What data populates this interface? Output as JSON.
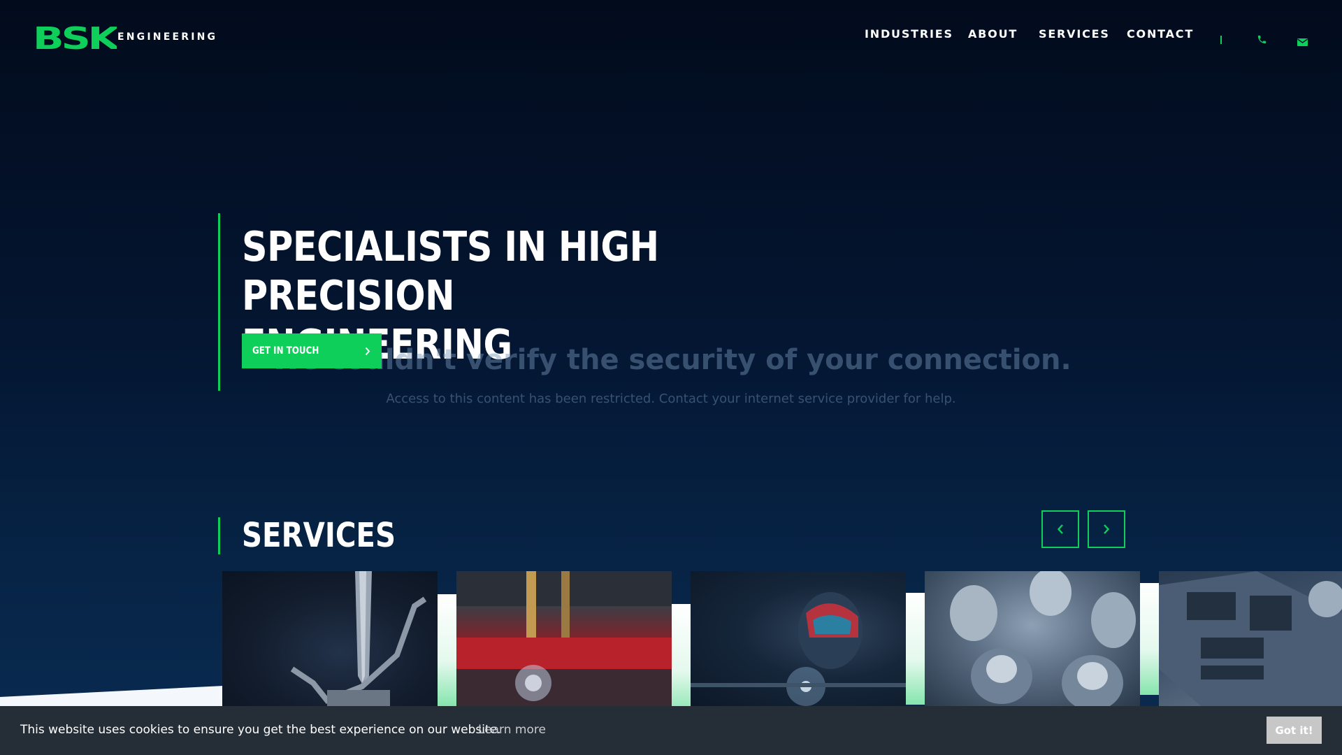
{
  "brand": {
    "logo_letters": "BSK",
    "logo_subtitle": "ENGINEERING",
    "accent_color": "#0fcf5b"
  },
  "nav": {
    "items": [
      "INDUSTRIES",
      "ABOUT",
      "SERVICES",
      "CONTACT"
    ],
    "separator": "|",
    "phone_icon": "phone-icon",
    "mail_icon": "mail-icon"
  },
  "hero": {
    "title_line1": "SPECIALISTS IN HIGH",
    "title_line2": "PRECISION ENGINEERING",
    "cta_label": "GET IN TOUCH",
    "cta_icon": "chevron-right-icon"
  },
  "overlay": {
    "title": "We couldn't verify the security of your connection.",
    "message": "Access to this content has been restricted. Contact your internet service provider for help."
  },
  "services": {
    "heading": "SERVICES",
    "prev_icon": "chevron-left-icon",
    "next_icon": "chevron-right-icon",
    "cards": [
      {
        "image": "press-brake-bending-image"
      },
      {
        "image": "laser-cutting-image"
      },
      {
        "image": "welding-image"
      },
      {
        "image": "machined-parts-image"
      },
      {
        "image": "sheet-metal-image"
      }
    ]
  },
  "cookie": {
    "text": "This website uses cookies to ensure you get the best experience on our website.",
    "link_label": "Learn more",
    "button_label": "Got it!"
  }
}
